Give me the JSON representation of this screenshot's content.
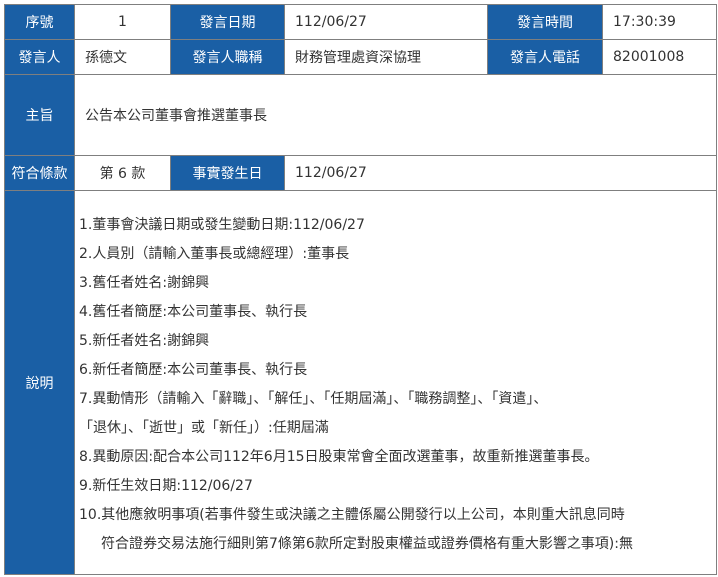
{
  "row1": {
    "seq_label": "序號",
    "seq_value": "1",
    "date_label": "發言日期",
    "date_value": "112/06/27",
    "time_label": "發言時間",
    "time_value": "17:30:39"
  },
  "row2": {
    "speaker_label": "發言人",
    "speaker_value": "孫德文",
    "title_label": "發言人職稱",
    "title_value": "財務管理處資深協理",
    "phone_label": "發言人電話",
    "phone_value": "82001008"
  },
  "row3": {
    "subject_label": "主旨",
    "subject_value": "公告本公司董事會推選董事長"
  },
  "row4": {
    "clause_label": "符合條款",
    "clause_value": "第 6 款",
    "fact_date_label": "事實發生日",
    "fact_date_value": "112/06/27"
  },
  "row5": {
    "desc_label": "說明",
    "lines": [
      "1.董事會決議日期或發生變動日期:112/06/27",
      "2.人員別（請輸入董事長或總經理）:董事長",
      "3.舊任者姓名:謝錦興",
      "4.舊任者簡歷:本公司董事長、執行長",
      "5.新任者姓名:謝錦興",
      "6.新任者簡歷:本公司董事長、執行長",
      "7.異動情形（請輸入「辭職」、「解任」、「任期屆滿」、「職務調整」、「資遣」、",
      "「退休」、「逝世」或「新任」）:任期屆滿",
      "8.異動原因:配合本公司112年6月15日股東常會全面改選董事，故重新推選董事長。",
      "9.新任生效日期:112/06/27",
      "10.其他應敘明事項(若事件發生或決議之主體係屬公開發行以上公司，本則重大訊息同時",
      "符合證券交易法施行細則第7條第6款所定對股東權益或證券價格有重大影響之事項):無"
    ]
  }
}
